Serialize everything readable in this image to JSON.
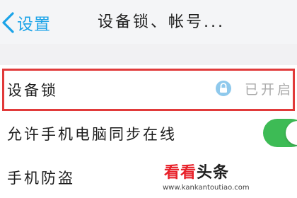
{
  "navbar": {
    "back_label": "设置",
    "title": "设备锁、帐号..."
  },
  "rows": [
    {
      "label": "设备锁",
      "status": "已开启",
      "status_icon": "lock-icon"
    },
    {
      "label": "允许手机电脑同步在线",
      "toggle_on": true
    },
    {
      "label": "手机防盗"
    }
  ],
  "watermark": {
    "accent": "看看",
    "rest": "头条",
    "url": "www.kankantoutiao.com"
  },
  "colors": {
    "accent_blue": "#1aa3e8",
    "highlight_red": "#e13a3a",
    "toggle_green": "#3dbb55",
    "lock_badge": "#8fc9ec"
  }
}
